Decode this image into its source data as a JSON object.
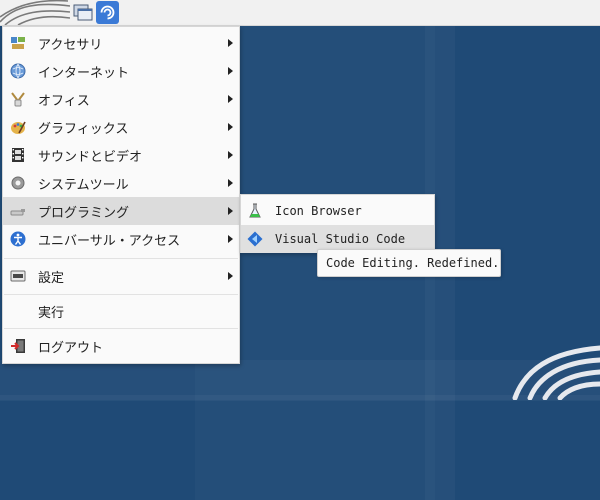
{
  "panel": {
    "icons": [
      "swirl-logo-icon",
      "show-desktop-icon",
      "app-menu-icon"
    ]
  },
  "menu": {
    "items": [
      {
        "label": "アクセサリ",
        "icon": "accessories-icon",
        "submenu": true
      },
      {
        "label": "インターネット",
        "icon": "internet-globe-icon",
        "submenu": true
      },
      {
        "label": "オフィス",
        "icon": "office-icon",
        "submenu": true
      },
      {
        "label": "グラフィックス",
        "icon": "graphics-palette-icon",
        "submenu": true
      },
      {
        "label": "サウンドとビデオ",
        "icon": "film-strip-icon",
        "submenu": true
      },
      {
        "label": "システムツール",
        "icon": "system-gear-icon",
        "submenu": true
      },
      {
        "label": "プログラミング",
        "icon": "programming-icon",
        "submenu": true,
        "active": true
      },
      {
        "label": "ユニバーサル・アクセス",
        "icon": "accessibility-icon",
        "submenu": true
      },
      {
        "label": "設定",
        "icon": "settings-icon",
        "submenu": true
      },
      {
        "label": "実行",
        "icon": "",
        "submenu": false
      },
      {
        "label": "ログアウト",
        "icon": "logout-icon",
        "submenu": false
      }
    ]
  },
  "submenu": {
    "items": [
      {
        "label": "Icon Browser",
        "icon": "flask-icon"
      },
      {
        "label": "Visual Studio Code",
        "icon": "vscode-icon",
        "active": true
      }
    ]
  },
  "tooltip": {
    "text": "Code Editing. Redefined."
  },
  "colors": {
    "desktop": "#1f4a76",
    "menu_bg": "#fafafa",
    "active_bg": "#dcdcdc",
    "panel_bg": "#f1f1f1"
  }
}
